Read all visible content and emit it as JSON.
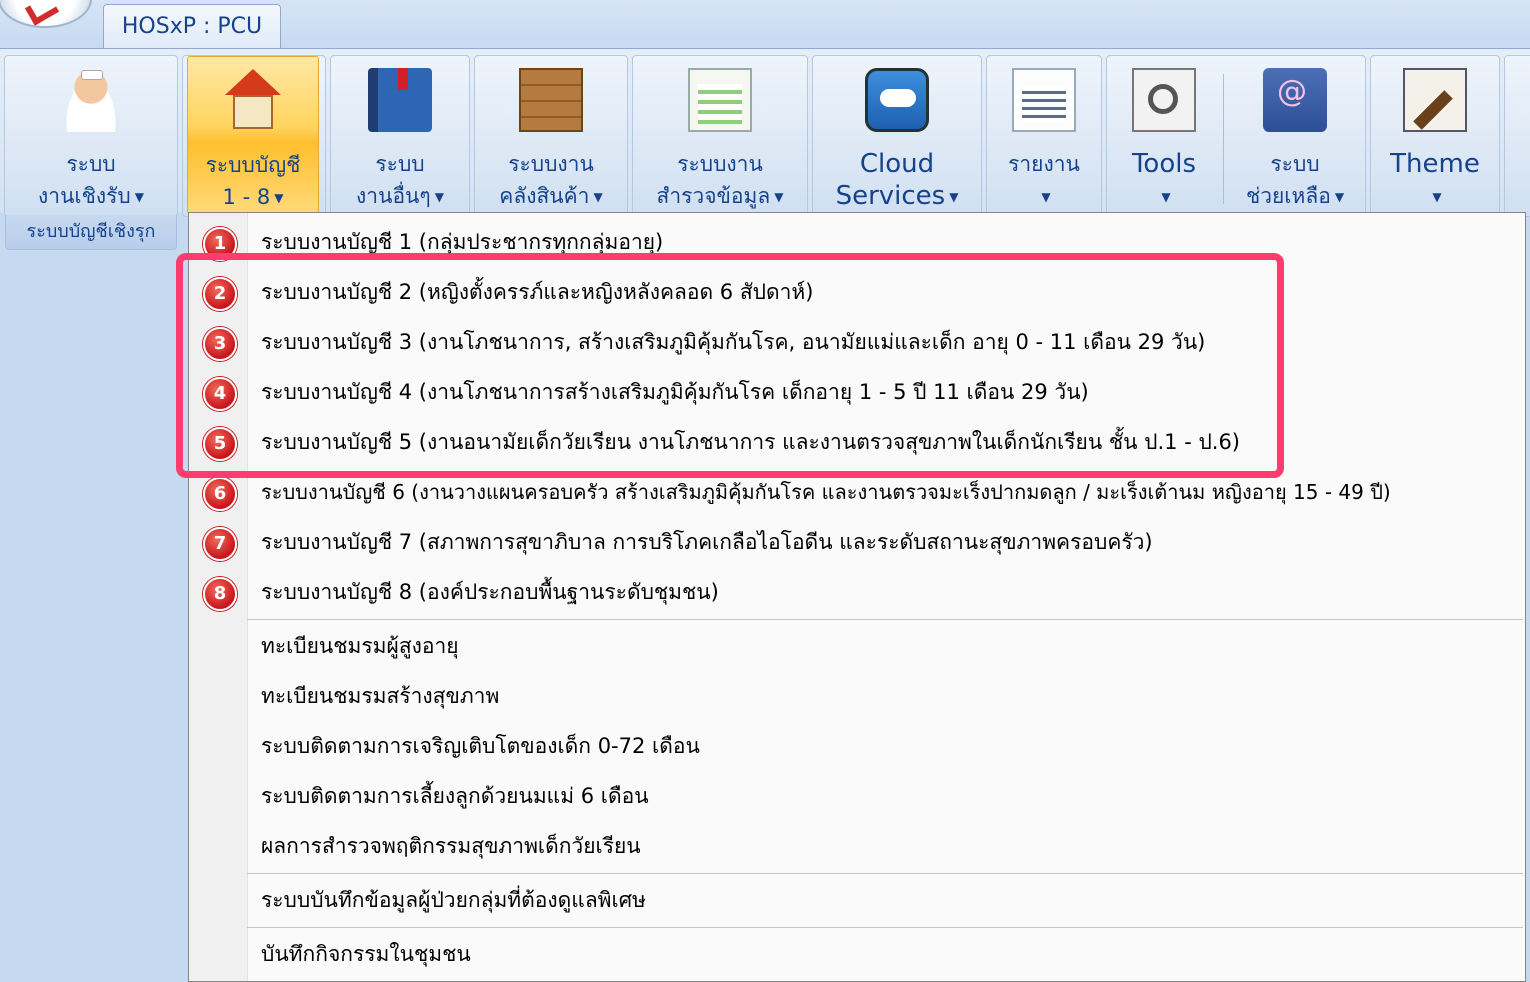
{
  "app_tab": "HOSxP : PCU",
  "ribbon": {
    "group_caption": "ระบบบัญชีเชิงรุก",
    "buttons": [
      {
        "line1": "ระบบ",
        "line2": "งานเชิงรับ",
        "icon": "nurse-icon"
      },
      {
        "line1": "ระบบบัญชี",
        "line2": "1 - 8",
        "icon": "house-icon"
      },
      {
        "line1": "ระบบ",
        "line2": "งานอื่นๆ",
        "icon": "book-icon"
      },
      {
        "line1": "ระบบงาน",
        "line2": "คลังสินค้า",
        "icon": "boxes-icon"
      },
      {
        "line1": "ระบบงาน",
        "line2": "สำรวจข้อมูล",
        "icon": "spreadsheet-icon"
      },
      {
        "line1": "Cloud",
        "line2": "Services",
        "icon": "cloud-icon"
      },
      {
        "line1": "รายงาน",
        "line2": "",
        "icon": "report-icon"
      },
      {
        "line1": "Tools",
        "line2": "",
        "icon": "tools-icon"
      },
      {
        "line1": "ระบบ",
        "line2": "ช่วยเหลือ",
        "icon": "help-book-icon"
      },
      {
        "line1": "Theme",
        "line2": "",
        "icon": "theme-brush-icon"
      }
    ]
  },
  "menu": {
    "numbered": [
      {
        "n": "1",
        "label": "ระบบงานบัญชี 1 (กลุ่มประชากรทุกกลุ่มอายุ)"
      },
      {
        "n": "2",
        "label": "ระบบงานบัญชี 2 (หญิงตั้งครรภ์และหญิงหลังคลอด 6 สัปดาห์)"
      },
      {
        "n": "3",
        "label": "ระบบงานบัญชี 3 (งานโภชนาการ, สร้างเสริมภูมิคุ้มกันโรค, อนามัยแม่และเด็ก อายุ 0 - 11 เดือน 29 วัน)"
      },
      {
        "n": "4",
        "label": "ระบบงานบัญชี 4 (งานโภชนาการสร้างเสริมภูมิคุ้มกันโรค เด็กอายุ 1 - 5 ปี 11 เดือน 29 วัน)"
      },
      {
        "n": "5",
        "label": "ระบบงานบัญชี 5 (งานอนามัยเด็กวัยเรียน งานโภชนาการ และงานตรวจสุขภาพในเด็กนักเรียน ชั้น ป.1 - ป.6)"
      },
      {
        "n": "6",
        "label": "ระบบงานบัญชี 6 (งานวางแผนครอบครัว สร้างเสริมภูมิคุ้มกันโรค และงานตรวจมะเร็งปากมดลูก / มะเร็งเต้านม หญิงอายุ 15 - 49 ปี)"
      },
      {
        "n": "7",
        "label": "ระบบงานบัญชี 7 (สภาพการสุขาภิบาล การบริโภคเกลือไอโอดีน และระดับสถานะสุขภาพครอบครัว)"
      },
      {
        "n": "8",
        "label": "ระบบงานบัญชี 8 (องค์ประกอบพื้นฐานระดับชุมชน)"
      }
    ],
    "extra": [
      "ทะเบียนชมรมผู้สูงอายุ",
      "ทะเบียนชมรมสร้างสุขภาพ",
      "ระบบติดตามการเจริญเติบโตของเด็ก 0-72 เดือน",
      "ระบบติดตามการเลี้ยงลูกด้วยนมแม่ 6 เดือน",
      "ผลการสำรวจพฤติกรรมสุขภาพเด็กวัยเรียน"
    ],
    "special": "ระบบบันทึกข้อมูลผู้ป่วยกลุ่มที่ต้องดูแลพิเศษ",
    "community": "บันทึกกิจกรรมในชุมชน"
  },
  "colors": {
    "highlight": "#ff3b6f",
    "badge": "#c8141b",
    "ribbon_text": "#15428b",
    "active_button": "#ffd35e"
  }
}
